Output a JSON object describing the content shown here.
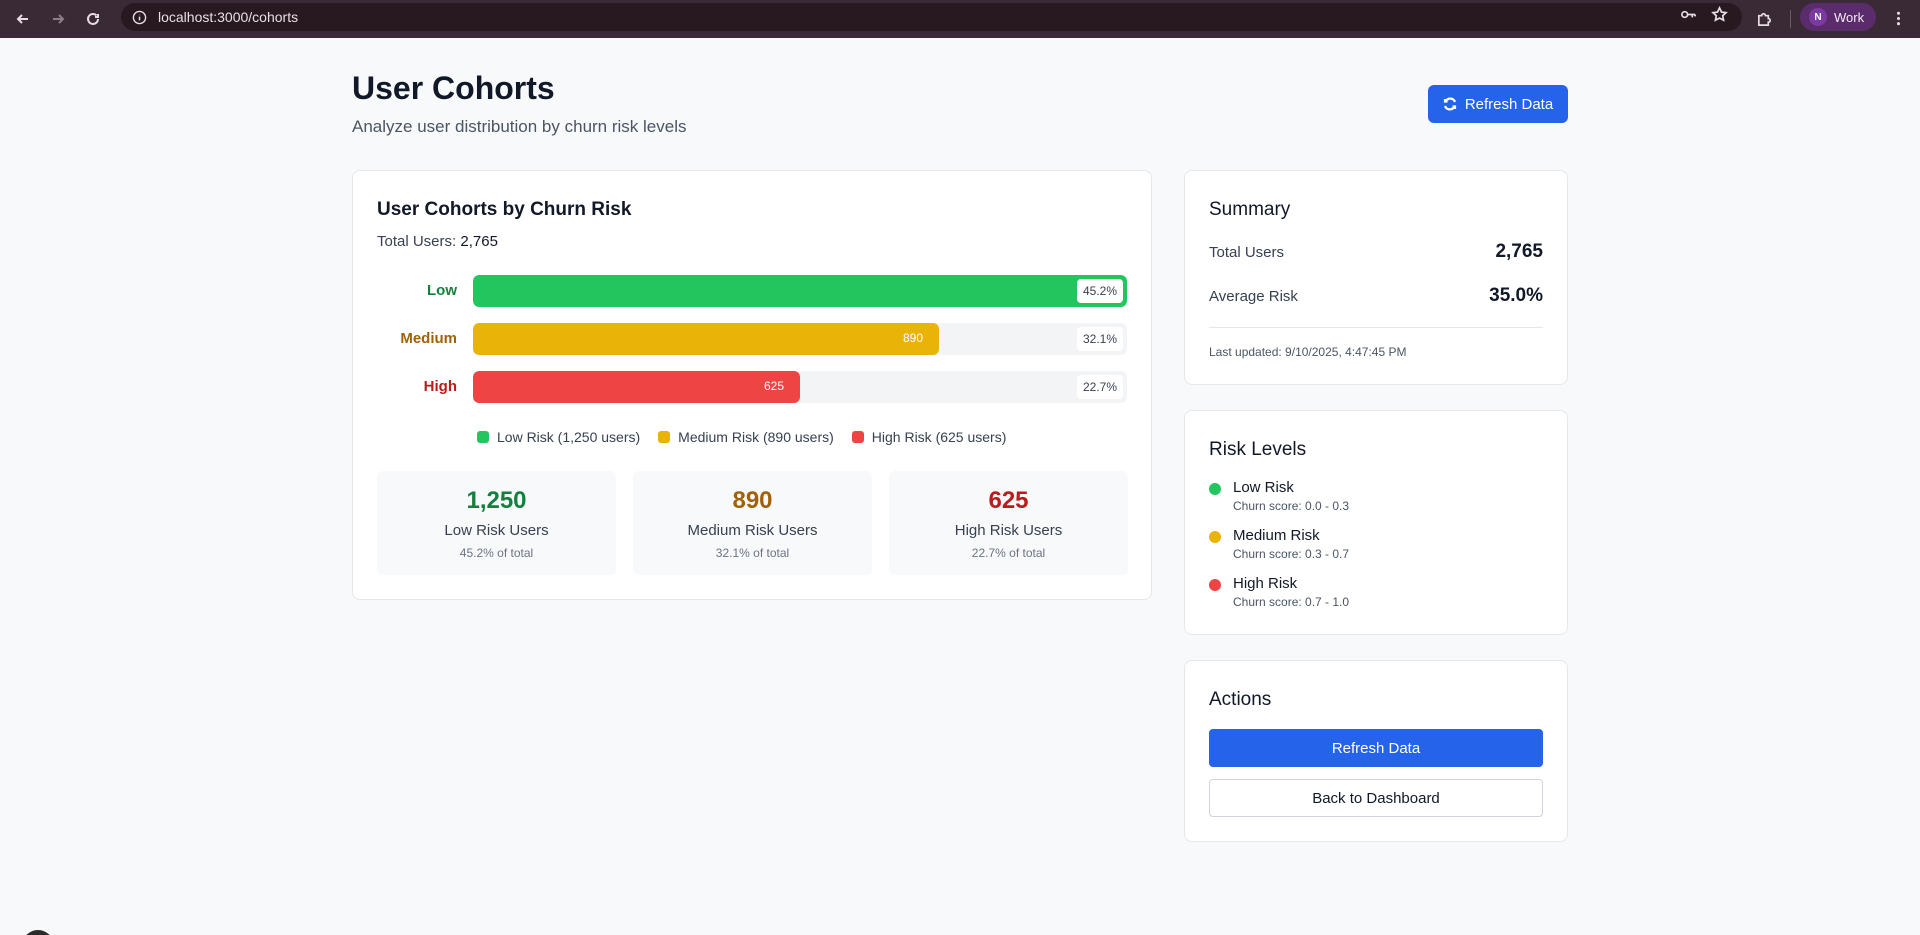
{
  "browser": {
    "url": "localhost:3000/cohorts",
    "profile_initial": "N",
    "profile_name": "Work"
  },
  "header": {
    "title": "User Cohorts",
    "subtitle": "Analyze user distribution by churn risk levels",
    "refresh_label": "Refresh Data"
  },
  "chart_card": {
    "title": "User Cohorts by Churn Risk",
    "total_label": "Total Users:",
    "total_value": "2,765"
  },
  "chart_data": {
    "type": "bar",
    "orientation": "horizontal",
    "categories": [
      "Low",
      "Medium",
      "High"
    ],
    "values": [
      1250,
      890,
      625
    ],
    "count_labels": [
      "",
      "890",
      "625"
    ],
    "percent_labels": [
      "45.2%",
      "32.1%",
      "22.7%"
    ],
    "fill_fractions": [
      1.0,
      0.712,
      0.5
    ],
    "colors": [
      "#22c55e",
      "#eab308",
      "#ef4444"
    ],
    "label_colors": [
      "#15803d",
      "#a16207",
      "#b91c1c"
    ],
    "legend": [
      "Low Risk (1,250 users)",
      "Medium Risk (890 users)",
      "High Risk (625 users)"
    ],
    "legend_placement": "bottom"
  },
  "stats": [
    {
      "value": "1,250",
      "label": "Low Risk Users",
      "pct": "45.2% of total",
      "color": "#15803d"
    },
    {
      "value": "890",
      "label": "Medium Risk Users",
      "pct": "32.1% of total",
      "color": "#a16207"
    },
    {
      "value": "625",
      "label": "High Risk Users",
      "pct": "22.7% of total",
      "color": "#b91c1c"
    }
  ],
  "summary": {
    "title": "Summary",
    "total_users_label": "Total Users",
    "total_users_value": "2,765",
    "avg_risk_label": "Average Risk",
    "avg_risk_value": "35.0%",
    "last_updated": "Last updated: 9/10/2025, 4:47:45 PM"
  },
  "risk_levels": {
    "title": "Risk Levels",
    "items": [
      {
        "name": "Low Risk",
        "score": "Churn score: 0.0 - 0.3",
        "color": "#22c55e"
      },
      {
        "name": "Medium Risk",
        "score": "Churn score: 0.3 - 0.7",
        "color": "#eab308"
      },
      {
        "name": "High Risk",
        "score": "Churn score: 0.7 - 1.0",
        "color": "#ef4444"
      }
    ]
  },
  "actions": {
    "title": "Actions",
    "refresh_label": "Refresh Data",
    "back_label": "Back to Dashboard"
  }
}
